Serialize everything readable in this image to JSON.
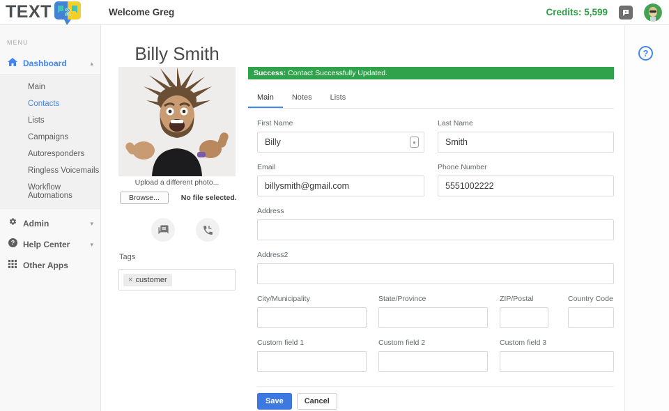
{
  "header": {
    "logo_text": "TEXT",
    "logo_bubble_number": "2",
    "welcome": "Welcome Greg",
    "credits": "Credits: 5,599"
  },
  "sidebar": {
    "menu_label": "MENU",
    "dashboard_label": "Dashboard",
    "items": [
      {
        "label": "Main",
        "active": false
      },
      {
        "label": "Contacts",
        "active": true
      },
      {
        "label": "Lists",
        "active": false
      },
      {
        "label": "Campaigns",
        "active": false
      },
      {
        "label": "Autoresponders",
        "active": false
      },
      {
        "label": "Ringless Voicemails",
        "active": false
      },
      {
        "label": "Workflow Automations",
        "active": false
      }
    ],
    "admin_label": "Admin",
    "help_label": "Help Center",
    "other_apps_label": "Other Apps"
  },
  "profile": {
    "name": "Billy Smith",
    "upload_text": "Upload a different photo...",
    "browse_label": "Browse...",
    "no_file_text": "No file selected.",
    "tags_label": "Tags",
    "tag": {
      "remove_glyph": "×",
      "label": "customer"
    }
  },
  "alert": {
    "prefix": "Success:",
    "message": " Contact Successfully Updated."
  },
  "tabs": [
    {
      "label": "Main",
      "active": true
    },
    {
      "label": "Notes",
      "active": false
    },
    {
      "label": "Lists",
      "active": false
    }
  ],
  "form": {
    "fields": {
      "first_name": {
        "label": "First Name",
        "value": "Billy"
      },
      "last_name": {
        "label": "Last Name",
        "value": "Smith"
      },
      "email": {
        "label": "Email",
        "value": "billysmith@gmail.com"
      },
      "phone": {
        "label": "Phone Number",
        "value": "5551002222"
      },
      "address": {
        "label": "Address",
        "value": ""
      },
      "address2": {
        "label": "Address2",
        "value": ""
      },
      "city": {
        "label": "City/Municipality",
        "value": ""
      },
      "state": {
        "label": "State/Province",
        "value": ""
      },
      "zip": {
        "label": "ZIP/Postal",
        "value": ""
      },
      "country_code": {
        "label": "Country Code",
        "value": ""
      },
      "custom1": {
        "label": "Custom field 1",
        "value": ""
      },
      "custom2": {
        "label": "Custom field 2",
        "value": ""
      },
      "custom3": {
        "label": "Custom field 3",
        "value": ""
      }
    },
    "save_label": "Save",
    "cancel_label": "Cancel"
  },
  "icons": {
    "help_glyph": "?",
    "chevron_up": "▴",
    "chevron_down": "▾"
  },
  "colors": {
    "accent_blue": "#4285f4",
    "success_green": "#31a24c",
    "credits_green": "#2f9e44",
    "save_blue": "#3e79e1"
  }
}
